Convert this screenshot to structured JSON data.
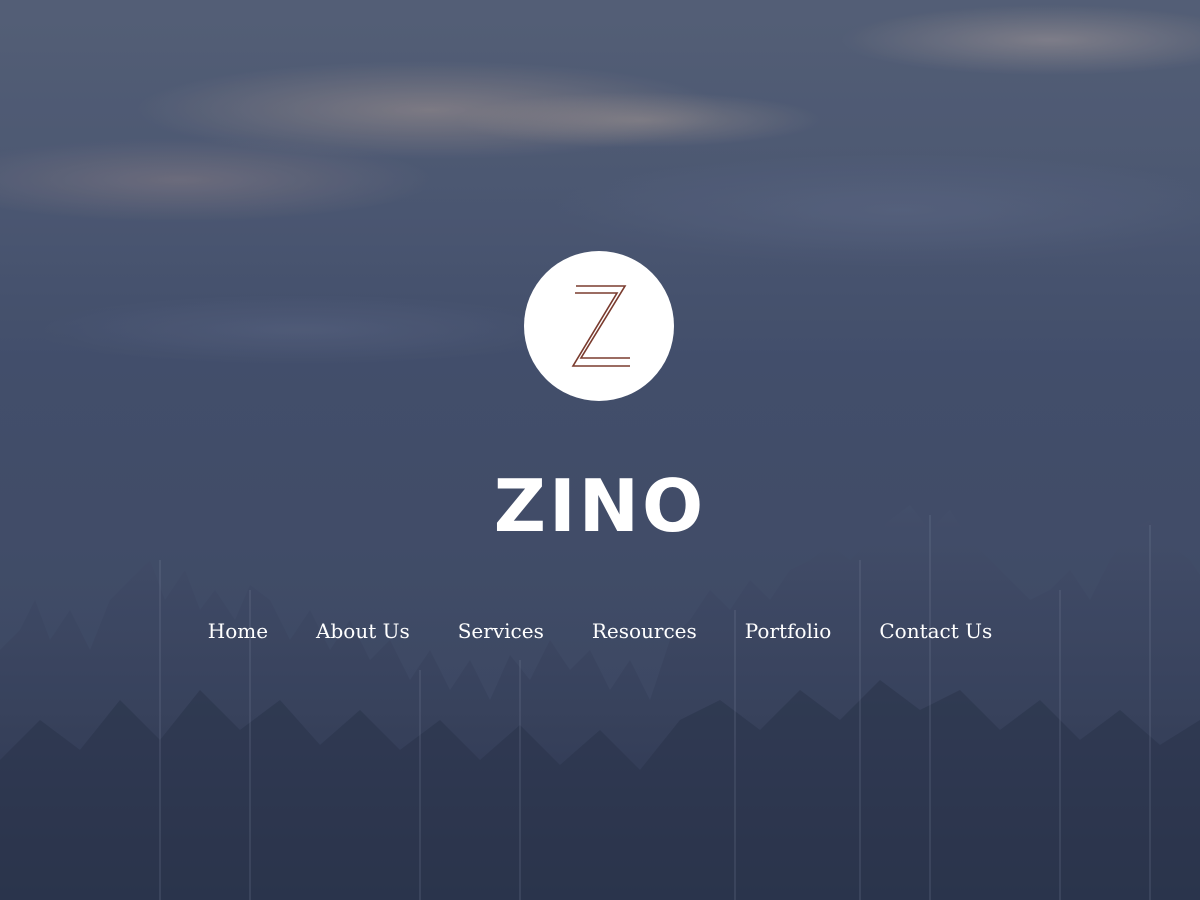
{
  "brand": {
    "logo_letter": "Z",
    "name": "ZINO"
  },
  "nav": {
    "items": [
      {
        "label": "Home"
      },
      {
        "label": "About Us"
      },
      {
        "label": "Services"
      },
      {
        "label": "Resources"
      },
      {
        "label": "Portfolio"
      },
      {
        "label": "Contact Us"
      }
    ]
  },
  "colors": {
    "logo_stroke": "#7a3b2e",
    "text": "#ffffff",
    "logo_background": "#ffffff"
  }
}
